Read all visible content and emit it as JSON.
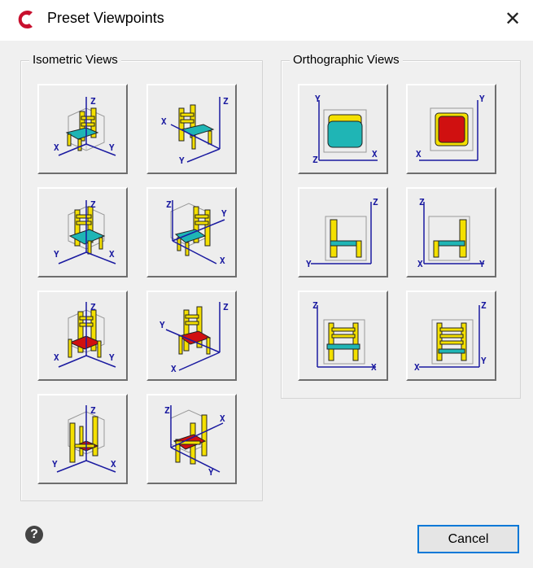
{
  "window": {
    "title": "Preset Viewpoints",
    "close_glyph": "✕"
  },
  "groups": {
    "isometric": {
      "label": "Isometric Views"
    },
    "orthographic": {
      "label": "Orthographic Views"
    }
  },
  "axis_labels": {
    "x": "X",
    "y": "Y",
    "z": "Z"
  },
  "footer": {
    "help_glyph": "?",
    "cancel_label": "Cancel"
  },
  "colors": {
    "seat_cyan": "#1fb5b5",
    "seat_red": "#d01010",
    "chair_yellow": "#f4e000",
    "axis_blue": "#1a1aa0"
  },
  "isometric_buttons": [
    {
      "name": "iso-view-1-button",
      "icon": "chair-iso-front-left-icon"
    },
    {
      "name": "iso-view-2-button",
      "icon": "chair-iso-front-right-icon"
    },
    {
      "name": "iso-view-3-button",
      "icon": "chair-iso-back-left-icon"
    },
    {
      "name": "iso-view-4-button",
      "icon": "chair-iso-back-right-icon"
    },
    {
      "name": "iso-view-5-button",
      "icon": "chair-iso-below-front-left-icon"
    },
    {
      "name": "iso-view-6-button",
      "icon": "chair-iso-below-front-right-icon"
    },
    {
      "name": "iso-view-7-button",
      "icon": "chair-iso-below-back-left-icon"
    },
    {
      "name": "iso-view-8-button",
      "icon": "chair-iso-below-back-right-icon"
    }
  ],
  "orthographic_buttons": [
    {
      "name": "top-view-button",
      "icon": "chair-top-view-icon"
    },
    {
      "name": "bottom-view-button",
      "icon": "chair-bottom-view-icon"
    },
    {
      "name": "left-view-button",
      "icon": "chair-left-view-icon"
    },
    {
      "name": "right-view-button",
      "icon": "chair-right-view-icon"
    },
    {
      "name": "front-view-button",
      "icon": "chair-front-view-icon"
    },
    {
      "name": "back-view-button",
      "icon": "chair-back-view-icon"
    }
  ]
}
